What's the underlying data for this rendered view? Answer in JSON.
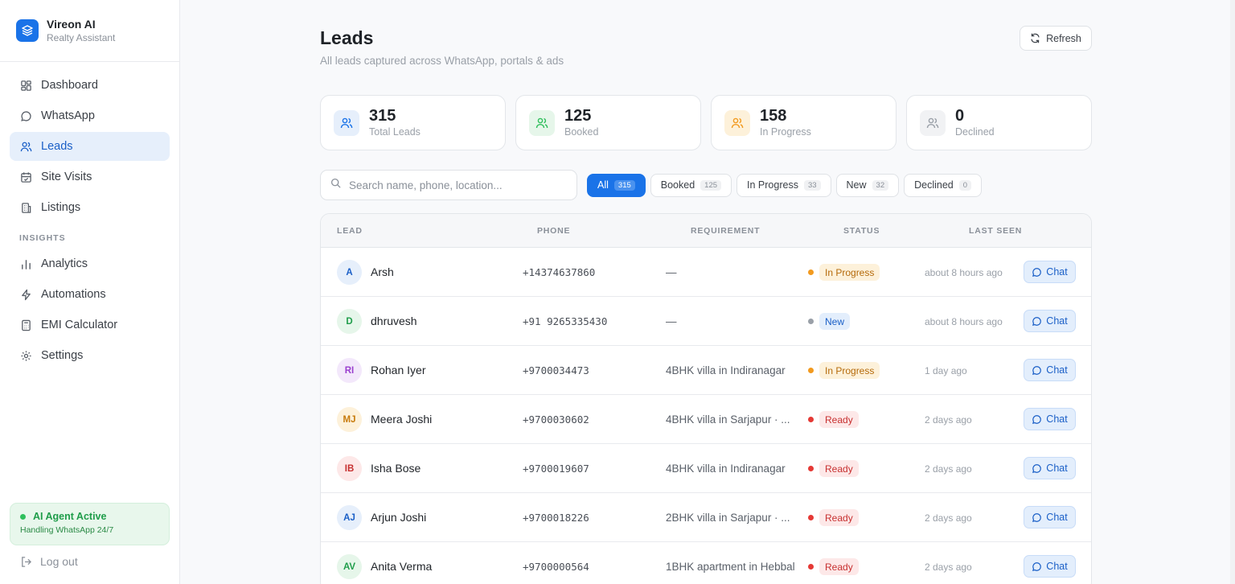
{
  "brand": {
    "name": "Vireon AI",
    "subtitle": "Realty Assistant",
    "accent": "#1a73e8"
  },
  "sidebar": {
    "items": [
      {
        "label": "Dashboard",
        "icon": "dashboard-icon"
      },
      {
        "label": "WhatsApp",
        "icon": "message-circle-icon"
      },
      {
        "label": "Leads",
        "icon": "users-icon",
        "active": true
      },
      {
        "label": "Site Visits",
        "icon": "calendar-check-icon"
      },
      {
        "label": "Listings",
        "icon": "building-icon"
      }
    ],
    "section_title": "INSIGHTS",
    "insight_items": [
      {
        "label": "Analytics",
        "icon": "bar-chart-icon"
      },
      {
        "label": "Automations",
        "icon": "zap-icon"
      },
      {
        "label": "EMI Calculator",
        "icon": "calculator-icon"
      },
      {
        "label": "Settings",
        "icon": "gear-icon"
      }
    ],
    "agent": {
      "title": "AI Agent Active",
      "subtitle": "Handling WhatsApp 24/7"
    },
    "logout_label": "Log out"
  },
  "header": {
    "title": "Leads",
    "subtitle": "All leads captured across WhatsApp, portals & ads",
    "refresh_label": "Refresh"
  },
  "stats": [
    {
      "value": "315",
      "label": "Total Leads",
      "color": "#1a73e8"
    },
    {
      "value": "125",
      "label": "Booked",
      "color": "#2fbf5c"
    },
    {
      "value": "158",
      "label": "In Progress",
      "color": "#f29a1f"
    },
    {
      "value": "0",
      "label": "Declined",
      "color": "#9aa0a8"
    }
  ],
  "search": {
    "placeholder": "Search name, phone, location..."
  },
  "filters": [
    {
      "label": "All",
      "count": "315",
      "active": true
    },
    {
      "label": "Booked",
      "count": "125"
    },
    {
      "label": "In Progress",
      "count": "33"
    },
    {
      "label": "New",
      "count": "32"
    },
    {
      "label": "Declined",
      "count": "0"
    }
  ],
  "table": {
    "columns": [
      "LEAD",
      "PHONE",
      "REQUIREMENT",
      "STATUS",
      "LAST SEEN"
    ],
    "chat_label": "Chat",
    "rows": [
      {
        "initials": "A",
        "name": "Arsh",
        "phone": "+14374637860",
        "requirement": "—",
        "status": "In Progress",
        "last_seen": "about 8 hours ago"
      },
      {
        "initials": "D",
        "name": "dhruvesh",
        "phone": "+91 9265335430",
        "requirement": "—",
        "status": "New",
        "last_seen": "about 8 hours ago"
      },
      {
        "initials": "RI",
        "name": "Rohan Iyer",
        "phone": "+9700034473",
        "requirement": "4BHK villa in Indiranagar",
        "status": "In Progress",
        "last_seen": "1 day ago"
      },
      {
        "initials": "MJ",
        "name": "Meera Joshi",
        "phone": "+9700030602",
        "requirement": "4BHK villa in Sarjapur · ...",
        "status": "Ready",
        "last_seen": "2 days ago"
      },
      {
        "initials": "IB",
        "name": "Isha Bose",
        "phone": "+9700019607",
        "requirement": "4BHK villa in Indiranagar",
        "status": "Ready",
        "last_seen": "2 days ago"
      },
      {
        "initials": "AJ",
        "name": "Arjun Joshi",
        "phone": "+9700018226",
        "requirement": "2BHK villa in Sarjapur · ...",
        "status": "Ready",
        "last_seen": "2 days ago"
      },
      {
        "initials": "AV",
        "name": "Anita Verma",
        "phone": "+9700000564",
        "requirement": "1BHK apartment in Hebbal",
        "status": "Ready",
        "last_seen": "2 days ago"
      }
    ]
  }
}
